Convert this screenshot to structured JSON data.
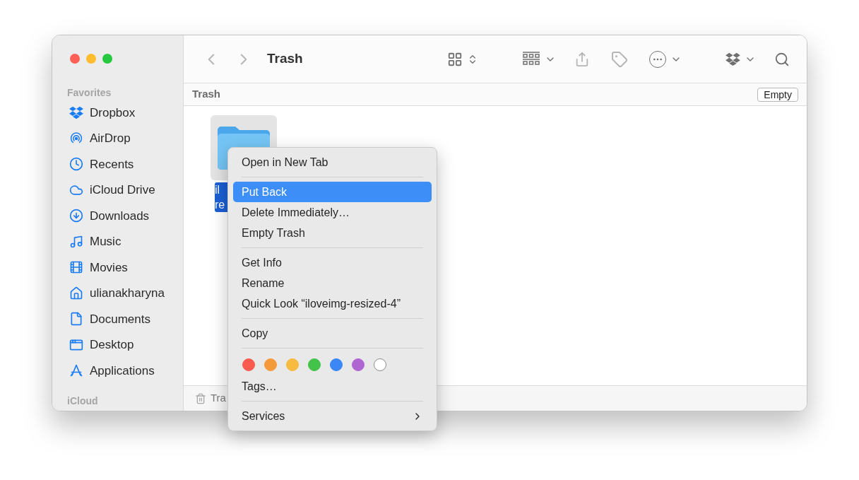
{
  "toolbar": {
    "title": "Trash"
  },
  "sidebar": {
    "sections": [
      {
        "title": "Favorites",
        "items": [
          {
            "label": "Dropbox"
          },
          {
            "label": "AirDrop"
          },
          {
            "label": "Recents"
          },
          {
            "label": "iCloud Drive"
          },
          {
            "label": "Downloads"
          },
          {
            "label": "Music"
          },
          {
            "label": "Movies"
          },
          {
            "label": "ulianakharyna"
          },
          {
            "label": "Documents"
          },
          {
            "label": "Desktop"
          },
          {
            "label": "Applications"
          }
        ]
      },
      {
        "title": "iCloud"
      }
    ]
  },
  "path_bar": {
    "title": "Trash",
    "button": "Empty"
  },
  "files": [
    {
      "name_lines": [
        "il",
        "re"
      ],
      "selected": true
    }
  ],
  "status_bar": {
    "text": "Tra"
  },
  "context_menu": {
    "items": [
      {
        "kind": "item",
        "label": "Open in New Tab",
        "selected": false
      },
      {
        "kind": "separator"
      },
      {
        "kind": "item",
        "label": "Put Back",
        "selected": true
      },
      {
        "kind": "item",
        "label": "Delete Immediately…",
        "selected": false
      },
      {
        "kind": "item",
        "label": "Empty Trash",
        "selected": false
      },
      {
        "kind": "separator"
      },
      {
        "kind": "item",
        "label": "Get Info",
        "selected": false
      },
      {
        "kind": "item",
        "label": "Rename",
        "selected": false
      },
      {
        "kind": "item",
        "label": "Quick Look “iloveimg-resized-4”",
        "selected": false
      },
      {
        "kind": "separator"
      },
      {
        "kind": "item",
        "label": "Copy",
        "selected": false
      },
      {
        "kind": "separator"
      },
      {
        "kind": "tags",
        "colors": [
          {
            "color": "#fa5b4f"
          },
          {
            "color": "#f59a3a"
          },
          {
            "color": "#f7bb3f"
          },
          {
            "color": "#44c34a"
          },
          {
            "color": "#3a87f5"
          },
          {
            "color": "#b066d2"
          },
          {
            "color": "#ffffff"
          }
        ]
      },
      {
        "kind": "item",
        "label": "Tags…",
        "selected": false
      },
      {
        "kind": "separator"
      },
      {
        "kind": "submenu",
        "label": "Services",
        "selected": false
      }
    ]
  }
}
